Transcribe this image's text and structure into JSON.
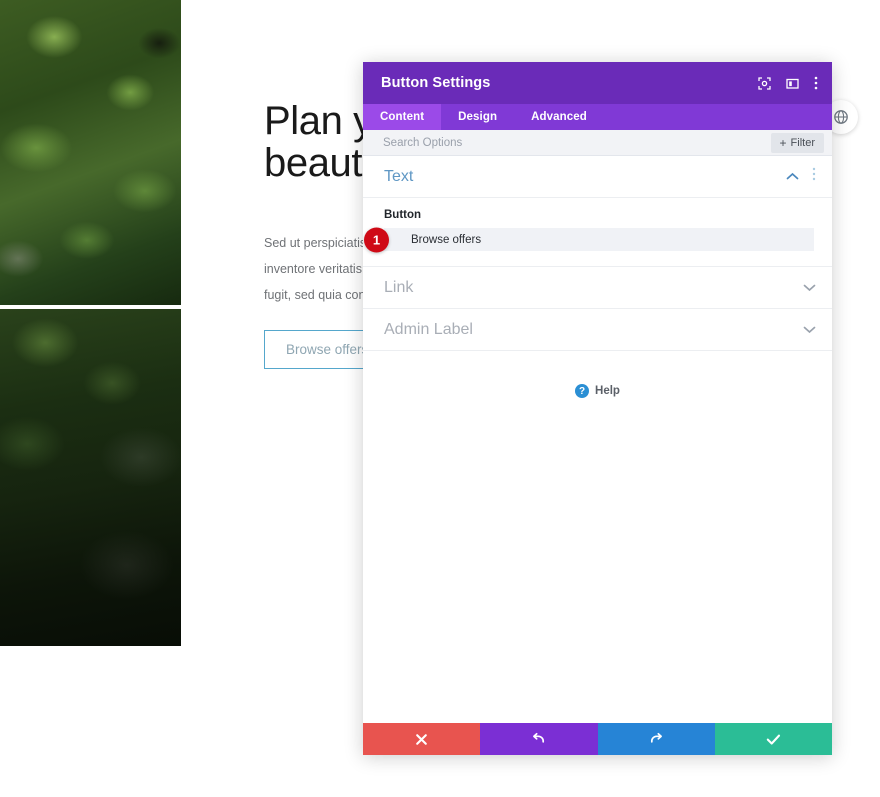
{
  "page": {
    "heading_line1": "Plan your",
    "heading_line2": "beautiful",
    "paragraph_line1": "Sed ut perspiciatis unde omnis iste natus error sit voluptatem accusantium doloremque ipsa quae",
    "paragraph_line2": "inventore veritatis et quasi architecto beatae vitae dicta sunt explicabo. Nemo enim ipsam natur aut o",
    "paragraph_line3": "fugit, sed quia consequuntur magni dolores eos qui ratione voluptatem sequi nesciunt.",
    "cta_label": "Browse offers"
  },
  "modal": {
    "title": "Button Settings",
    "header_icons": [
      {
        "name": "fullscreen-icon",
        "label": "Fullscreen"
      },
      {
        "name": "layout-icon",
        "label": "Layout"
      },
      {
        "name": "kebab-menu-icon",
        "label": "More options"
      }
    ],
    "tabs": [
      {
        "label": "Content",
        "active": true
      },
      {
        "label": "Design",
        "active": false
      },
      {
        "label": "Advanced",
        "active": false
      }
    ],
    "search": {
      "placeholder": "Search Options",
      "value": ""
    },
    "filter_label": "Filter",
    "filter_plus": "+",
    "sections": [
      {
        "title": "Text",
        "state": "expanded",
        "field_label": "Button",
        "field_value": "Browse offers",
        "badge": "1"
      },
      {
        "title": "Link",
        "state": "collapsed"
      },
      {
        "title": "Admin Label",
        "state": "collapsed"
      }
    ],
    "help_label": "Help",
    "help_glyph": "?",
    "footer": [
      {
        "name": "cancel-button",
        "glyph": "✖",
        "color": "#e8544f"
      },
      {
        "name": "undo-button",
        "glyph": "↺",
        "color": "#7b2fd4"
      },
      {
        "name": "redo-button",
        "glyph": "↻",
        "color": "#2684d6"
      },
      {
        "name": "save-button",
        "glyph": "✔",
        "color": "#2bbd96"
      }
    ]
  },
  "colors": {
    "header_purple": "#6a2bb8",
    "tabbar_purple": "#8039d6",
    "tab_active_purple": "#9b4ae8",
    "badge_red": "#cf0a16",
    "section_blue": "#5f97c4",
    "help_blue": "#2b8fd4"
  }
}
